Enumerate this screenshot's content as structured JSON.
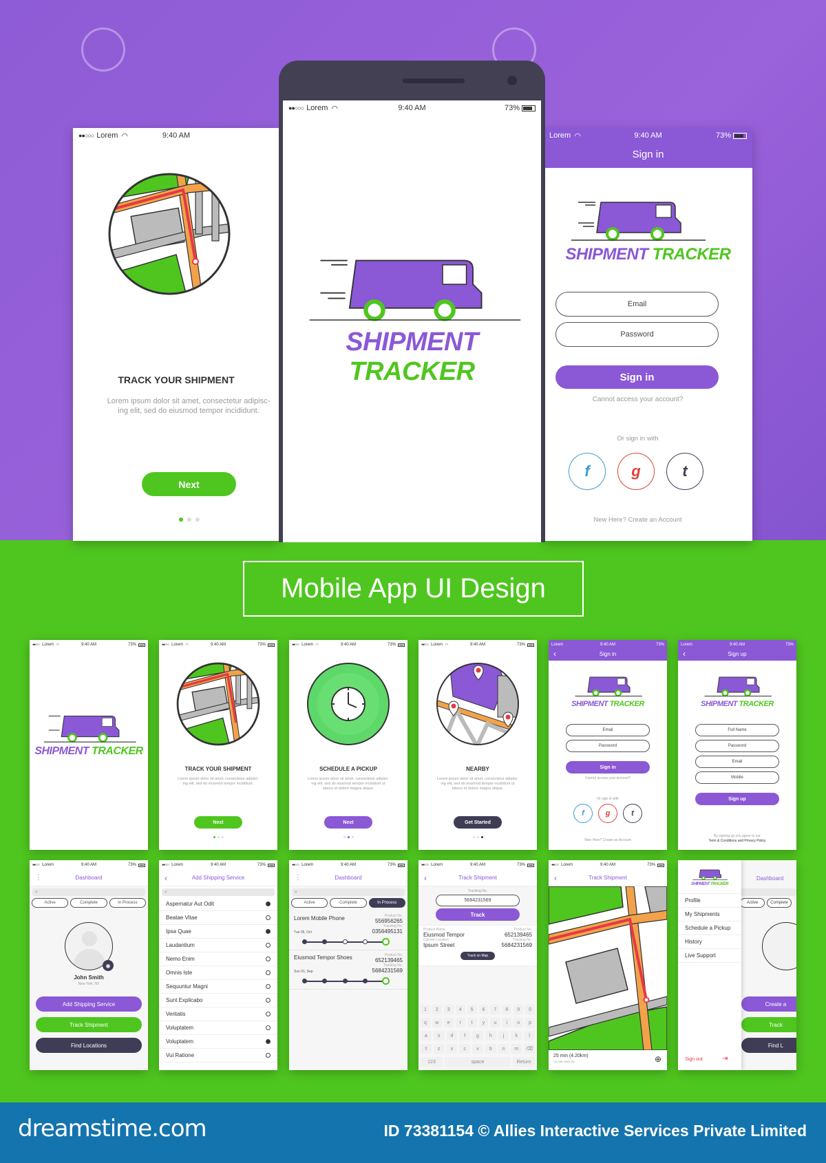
{
  "status_bar": {
    "carrier": "Lorem",
    "time": "9:40 AM",
    "battery": "73%"
  },
  "hero": {
    "onboard": {
      "title": "TRACK YOUR SHIPMENT",
      "body": "Lorem ipsum dolor sit amet, consectetur adipisc-ing elit, sed do eiusmod tempor incididunt.",
      "next_label": "Next",
      "pager": {
        "count": 3,
        "active": 1
      }
    },
    "splash": {
      "logo_part1": "SHIPMENT",
      "logo_part2": "TRACKER"
    },
    "signin": {
      "header_title": "Sign in",
      "email_placeholder": "Email",
      "password_placeholder": "Password",
      "signin_label": "Sign in",
      "cannot_access": "Cannot access your account?",
      "or_sign_in_with": "Or sign in with",
      "social": [
        {
          "label": "f",
          "name": "facebook",
          "color": "#3b9bd1"
        },
        {
          "label": "g",
          "name": "google",
          "color": "#e0413f"
        },
        {
          "label": "t",
          "name": "tumblr",
          "color": "#3f3d56"
        }
      ],
      "new_here": "New Here? Create an Account"
    }
  },
  "banner": {
    "title": "Mobile App UI Design"
  },
  "grid_row1": {
    "splash": {
      "logo_part1": "SHIPMENT",
      "logo_part2": "TRACKER"
    },
    "onboard1": {
      "title": "TRACK YOUR SHIPMENT",
      "body": "Lorem ipsum dolor sit amet, consectetur adipisc-ing elit, sed do eiusmod tempor incididunt.",
      "button": "Next"
    },
    "onboard2": {
      "title": "SCHEDULE A PICKUP",
      "body": "Lorem ipsum dolor sit amet, consectetur adipisc-ing elit, sed do eiusmod tempor incididunt ut labore et dolore magna aliqua.",
      "button": "Next"
    },
    "onboard3": {
      "title": "NEARBY",
      "body": "Lorem ipsum dolor sit amet, consectetur adipisc-ing elit, sed do eiusmod tempor incididunt ut labore et dolore magna aliqua.",
      "button": "Get Started"
    },
    "signin": {
      "header": "Sign in",
      "email": "Email",
      "password": "Password",
      "button": "Sign in",
      "cannot_access": "Cannot access your account?",
      "or_sign_in_with": "Or sign in with",
      "new_here": "New Here? Create an Account"
    },
    "signup": {
      "header": "Sign up",
      "fields": [
        "Full Name",
        "Password",
        "Email",
        "Mobile"
      ],
      "button": "Sign up",
      "terms_line1": "By signing up you agree to our",
      "terms_line2": "Term & Conditions and Privacy Policy"
    }
  },
  "grid_row2": {
    "dashboard": {
      "title": "Dashboard",
      "tabs": [
        "Active",
        "Complete",
        "In Process"
      ],
      "user_name": "John Smith",
      "user_location": "New York, NY",
      "buttons": [
        "Add Shipping Service",
        "Track Shipment",
        "Find Locations"
      ]
    },
    "add_service": {
      "title": "Add Shipping Service",
      "items": [
        {
          "label": "Aspernatur Aut Odit",
          "selected": true
        },
        {
          "label": "Beatae Vitae",
          "selected": false
        },
        {
          "label": "Ipsa Quae",
          "selected": true
        },
        {
          "label": "Laudantium",
          "selected": false
        },
        {
          "label": "Nemo Enim",
          "selected": false
        },
        {
          "label": "Omnis Iste",
          "selected": false
        },
        {
          "label": "Sequuntur Magni",
          "selected": false
        },
        {
          "label": "Sunt Explicabo",
          "selected": false
        },
        {
          "label": "Veritatis",
          "selected": false
        },
        {
          "label": "Voluptatem",
          "selected": false
        },
        {
          "label": "Voluptatem",
          "selected": true
        },
        {
          "label": "Vui Ratione",
          "selected": false
        }
      ]
    },
    "dashboard_in_process": {
      "title": "Dashboard",
      "tabs": [
        "Active",
        "Complete",
        "In Process"
      ],
      "shipments": [
        {
          "name": "Lorem Mobile Phone",
          "date": "Tue 05, Oct",
          "product_label": "Product No.",
          "product_no": "556956265",
          "tracking_label": "Tracking No.",
          "tracking_no": "0356495131",
          "progress_steps_done": 2,
          "progress_steps_total": 5
        },
        {
          "name": "Eiusmod Tempor Shoes",
          "date": "Sun 01, Sep",
          "product_label": "Product No.",
          "product_no": "652139465",
          "tracking_label": "Tracking No.",
          "tracking_no": "5684231569",
          "progress_steps_done": 4,
          "progress_steps_total": 5
        }
      ]
    },
    "track_shipment": {
      "title": "Track Shipment",
      "tracking_label": "Tracking No.",
      "tracking_value": "5684231569",
      "track_button": "Track",
      "product_name_label": "Product Name",
      "product_name": "Eiusmod Tempor",
      "location_label": "Current Location",
      "location": "Ipsum Street",
      "product_no_label": "Product No.",
      "product_no": "652139465",
      "tracking_no_label": "Tracking No.",
      "tracking_no": "5684231569",
      "map_button": "Track on Map",
      "keyboard": {
        "row1": [
          "1",
          "2",
          "3",
          "4",
          "5",
          "6",
          "7",
          "8",
          "9",
          "0"
        ],
        "row2": [
          "q",
          "w",
          "e",
          "r",
          "t",
          "y",
          "u",
          "i",
          "o",
          "p"
        ],
        "row3": [
          "a",
          "s",
          "d",
          "f",
          "g",
          "h",
          "j",
          "k",
          "l"
        ],
        "row4": [
          "⇧",
          "z",
          "x",
          "c",
          "v",
          "b",
          "n",
          "m",
          "⌫"
        ],
        "row5": [
          "123",
          "space",
          "Return"
        ]
      }
    },
    "track_map": {
      "title": "Track Shipment",
      "eta": "25 min (4.20km)",
      "via": "Via 18th Main Rd"
    },
    "side_menu": {
      "logo_part1": "SHIPMENT",
      "logo_part2": "TRACKER",
      "items": [
        "Profile",
        "My Shipments",
        "Schedule a Pickup",
        "History",
        "Live Support"
      ],
      "sign_out": "Sign out"
    },
    "dashboard_partial": {
      "title": "Dashboard",
      "tabs": [
        "Active",
        "Complete"
      ],
      "buttons": [
        "Create a",
        "Track",
        "Find L"
      ]
    }
  },
  "footer": {
    "site": "dreamstime.com",
    "credit": "ID 73381154 © Allies Interactive Services Private Limited"
  },
  "colors": {
    "purple": "#8b58d6",
    "green": "#4fc61f",
    "dark": "#3f3d56",
    "footer_blue": "#1474ae"
  }
}
